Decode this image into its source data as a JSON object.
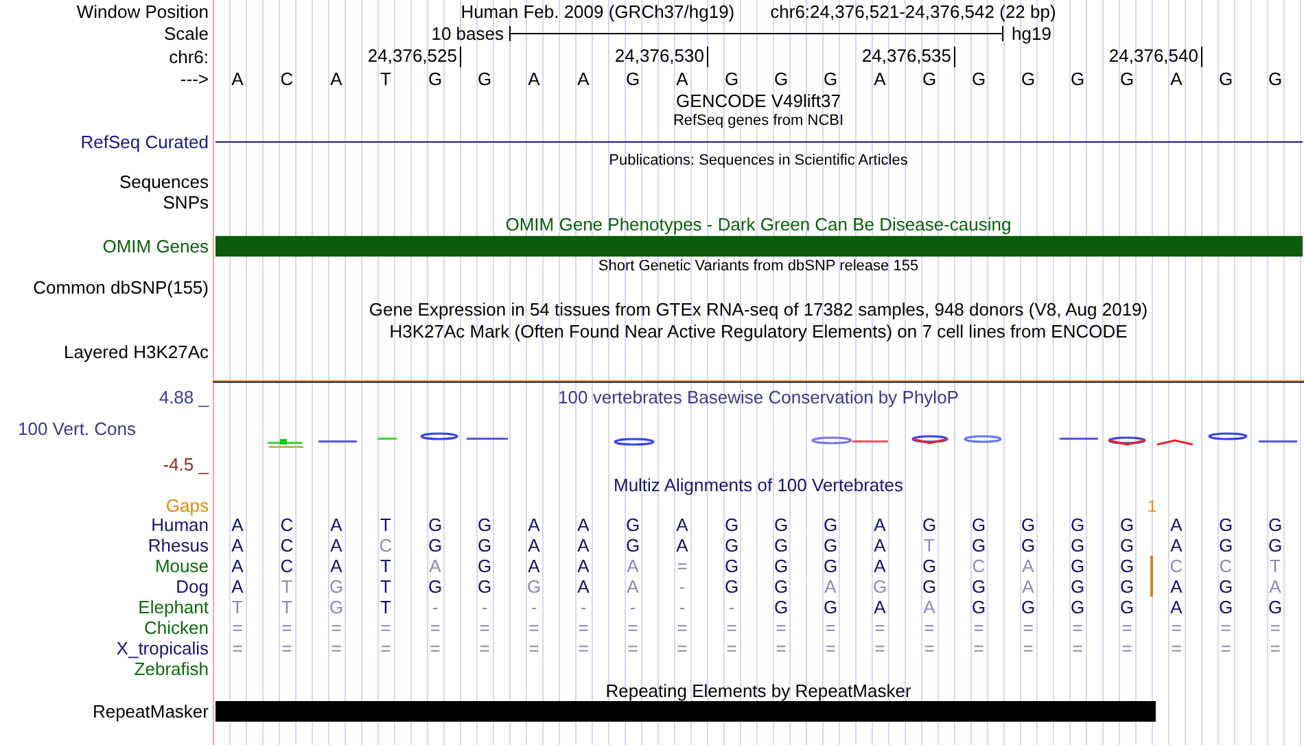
{
  "window_position": {
    "label": "Window Position",
    "assembly": "Human Feb. 2009 (GRCh37/hg19)",
    "position": "chr6:24,376,521-24,376,542 (22 bp)"
  },
  "scale": {
    "label": "Scale",
    "length": "10 bases",
    "assembly": "hg19"
  },
  "ruler": {
    "label": "chr6:",
    "ticks": [
      "24,376,525",
      "24,376,530",
      "24,376,535",
      "24,376,540"
    ]
  },
  "sequence": {
    "label": "--->",
    "bases": [
      "A",
      "C",
      "A",
      "T",
      "G",
      "G",
      "A",
      "A",
      "G",
      "A",
      "G",
      "G",
      "G",
      "A",
      "G",
      "G",
      "G",
      "G",
      "G",
      "A",
      "G",
      "G"
    ]
  },
  "tracks": [
    {
      "kind": "title",
      "text": "GENCODE V49lift37"
    },
    {
      "kind": "note",
      "text": "RefSeq genes from NCBI"
    },
    {
      "kind": "line",
      "label": "RefSeq Curated",
      "color": "#1a1a80"
    },
    {
      "kind": "note",
      "text": "Publications: Sequences in Scientific Articles"
    },
    {
      "kind": "label",
      "label": "Sequences"
    },
    {
      "kind": "label",
      "label": "SNPs"
    },
    {
      "kind": "title",
      "text": "OMIM Gene Phenotypes - Dark Green Can Be Disease-causing",
      "color": "#0b5d0b"
    },
    {
      "kind": "bar",
      "label": "OMIM Genes",
      "color": "#0b5d0b"
    },
    {
      "kind": "note",
      "text": "Short Genetic Variants from dbSNP release 155"
    },
    {
      "kind": "label",
      "label": "Common dbSNP(155)"
    },
    {
      "kind": "title",
      "text": "Gene Expression in 54 tissues from GTEx RNA-seq of 17382 samples, 948 donors (V8, Aug 2019)"
    },
    {
      "kind": "title",
      "text": "H3K27Ac Mark (Often Found Near Active Regulatory Elements) on 7 cell lines from ENCODE"
    },
    {
      "kind": "label",
      "label": "Layered H3K27Ac"
    }
  ],
  "conservation": {
    "title": "100 vertebrates Basewise Conservation by PhyloP",
    "label": "100 Vert. Cons",
    "max": "4.88 _",
    "min": "-4.5 _"
  },
  "multiz": {
    "title": "Multiz Alignments of 100 Vertebrates",
    "gaps_label": "Gaps",
    "gap_count": "1",
    "species": [
      {
        "name": "Human",
        "color": "#14146e",
        "bases": [
          {
            "base": "A",
            "faded": false,
            "insertion": false
          },
          {
            "base": "C",
            "faded": false,
            "insertion": false
          },
          {
            "base": "A",
            "faded": false,
            "insertion": false
          },
          {
            "base": "T",
            "faded": false,
            "insertion": false
          },
          {
            "base": "G",
            "faded": false,
            "insertion": false
          },
          {
            "base": "G",
            "faded": false,
            "insertion": false
          },
          {
            "base": "A",
            "faded": false,
            "insertion": false
          },
          {
            "base": "A",
            "faded": false,
            "insertion": false
          },
          {
            "base": "G",
            "faded": false,
            "insertion": false
          },
          {
            "base": "A",
            "faded": false,
            "insertion": false
          },
          {
            "base": "G",
            "faded": false,
            "insertion": false
          },
          {
            "base": "G",
            "faded": false,
            "insertion": false
          },
          {
            "base": "G",
            "faded": false,
            "insertion": false
          },
          {
            "base": "A",
            "faded": false,
            "insertion": false
          },
          {
            "base": "G",
            "faded": false,
            "insertion": false
          },
          {
            "base": "G",
            "faded": false,
            "insertion": false
          },
          {
            "base": "G",
            "faded": false,
            "insertion": false
          },
          {
            "base": "G",
            "faded": false,
            "insertion": false
          },
          {
            "base": "G",
            "faded": false,
            "insertion": false
          },
          {
            "base": "A",
            "faded": false,
            "insertion": false
          },
          {
            "base": "G",
            "faded": false,
            "insertion": false
          },
          {
            "base": "G",
            "faded": false,
            "insertion": false
          }
        ]
      },
      {
        "name": "Rhesus",
        "color": "#14146e",
        "bases": [
          {
            "base": "A",
            "faded": false,
            "insertion": false
          },
          {
            "base": "C",
            "faded": false,
            "insertion": false
          },
          {
            "base": "A",
            "faded": false,
            "insertion": false
          },
          {
            "base": "C",
            "faded": true,
            "insertion": false
          },
          {
            "base": "G",
            "faded": false,
            "insertion": false
          },
          {
            "base": "G",
            "faded": false,
            "insertion": false
          },
          {
            "base": "A",
            "faded": false,
            "insertion": false
          },
          {
            "base": "A",
            "faded": false,
            "insertion": false
          },
          {
            "base": "G",
            "faded": false,
            "insertion": false
          },
          {
            "base": "A",
            "faded": false,
            "insertion": false
          },
          {
            "base": "G",
            "faded": false,
            "insertion": false
          },
          {
            "base": "G",
            "faded": false,
            "insertion": false
          },
          {
            "base": "G",
            "faded": false,
            "insertion": false
          },
          {
            "base": "A",
            "faded": false,
            "insertion": false
          },
          {
            "base": "T",
            "faded": true,
            "insertion": false
          },
          {
            "base": "G",
            "faded": false,
            "insertion": false
          },
          {
            "base": "G",
            "faded": false,
            "insertion": false
          },
          {
            "base": "G",
            "faded": false,
            "insertion": false
          },
          {
            "base": "G",
            "faded": false,
            "insertion": false
          },
          {
            "base": "A",
            "faded": false,
            "insertion": false
          },
          {
            "base": "G",
            "faded": false,
            "insertion": false
          },
          {
            "base": "G",
            "faded": false,
            "insertion": false
          }
        ]
      },
      {
        "name": "Mouse",
        "color": "#0b6b0b",
        "bases": [
          {
            "base": "A",
            "faded": false,
            "insertion": false
          },
          {
            "base": "C",
            "faded": false,
            "insertion": false
          },
          {
            "base": "A",
            "faded": false,
            "insertion": false
          },
          {
            "base": "T",
            "faded": false,
            "insertion": false
          },
          {
            "base": "A",
            "faded": true,
            "insertion": false
          },
          {
            "base": "G",
            "faded": false,
            "insertion": false
          },
          {
            "base": "A",
            "faded": false,
            "insertion": false
          },
          {
            "base": "A",
            "faded": false,
            "insertion": false
          },
          {
            "base": "A",
            "faded": true,
            "insertion": false
          },
          {
            "base": "=",
            "faded": true,
            "insertion": false
          },
          {
            "base": "G",
            "faded": false,
            "insertion": false
          },
          {
            "base": "G",
            "faded": false,
            "insertion": false
          },
          {
            "base": "G",
            "faded": false,
            "insertion": false
          },
          {
            "base": "A",
            "faded": false,
            "insertion": false
          },
          {
            "base": "G",
            "faded": false,
            "insertion": false
          },
          {
            "base": "C",
            "faded": true,
            "insertion": false
          },
          {
            "base": "A",
            "faded": true,
            "insertion": false
          },
          {
            "base": "G",
            "faded": false,
            "insertion": false
          },
          {
            "base": "G",
            "faded": false,
            "insertion": false
          },
          {
            "base": "C",
            "faded": true,
            "insertion": true
          },
          {
            "base": "C",
            "faded": true,
            "insertion": false
          },
          {
            "base": "T",
            "faded": true,
            "insertion": false
          }
        ]
      },
      {
        "name": "Dog",
        "color": "#14146e",
        "bases": [
          {
            "base": "A",
            "faded": false,
            "insertion": false
          },
          {
            "base": "T",
            "faded": true,
            "insertion": false
          },
          {
            "base": "G",
            "faded": true,
            "insertion": false
          },
          {
            "base": "T",
            "faded": false,
            "insertion": false
          },
          {
            "base": "G",
            "faded": false,
            "insertion": false
          },
          {
            "base": "G",
            "faded": false,
            "insertion": false
          },
          {
            "base": "G",
            "faded": true,
            "insertion": false
          },
          {
            "base": "A",
            "faded": false,
            "insertion": false
          },
          {
            "base": "A",
            "faded": true,
            "insertion": false
          },
          {
            "base": "-",
            "faded": true,
            "insertion": false
          },
          {
            "base": "G",
            "faded": false,
            "insertion": false
          },
          {
            "base": "G",
            "faded": false,
            "insertion": false
          },
          {
            "base": "A",
            "faded": true,
            "insertion": false
          },
          {
            "base": "G",
            "faded": true,
            "insertion": false
          },
          {
            "base": "G",
            "faded": false,
            "insertion": false
          },
          {
            "base": "G",
            "faded": false,
            "insertion": false
          },
          {
            "base": "A",
            "faded": true,
            "insertion": false
          },
          {
            "base": "G",
            "faded": false,
            "insertion": false
          },
          {
            "base": "G",
            "faded": false,
            "insertion": false
          },
          {
            "base": "A",
            "faded": false,
            "insertion": true
          },
          {
            "base": "G",
            "faded": false,
            "insertion": false
          },
          {
            "base": "A",
            "faded": true,
            "insertion": false
          }
        ]
      },
      {
        "name": "Elephant",
        "color": "#0b6b0b",
        "bases": [
          {
            "base": "T",
            "faded": true,
            "insertion": false
          },
          {
            "base": "T",
            "faded": true,
            "insertion": false
          },
          {
            "base": "G",
            "faded": true,
            "insertion": false
          },
          {
            "base": "T",
            "faded": false,
            "insertion": false
          },
          {
            "base": "-",
            "faded": true,
            "insertion": false
          },
          {
            "base": "-",
            "faded": true,
            "insertion": false
          },
          {
            "base": "-",
            "faded": true,
            "insertion": false
          },
          {
            "base": "-",
            "faded": true,
            "insertion": false
          },
          {
            "base": "-",
            "faded": true,
            "insertion": false
          },
          {
            "base": "-",
            "faded": true,
            "insertion": false
          },
          {
            "base": "-",
            "faded": true,
            "insertion": false
          },
          {
            "base": "G",
            "faded": false,
            "insertion": false
          },
          {
            "base": "G",
            "faded": false,
            "insertion": false
          },
          {
            "base": "A",
            "faded": false,
            "insertion": false
          },
          {
            "base": "A",
            "faded": true,
            "insertion": false
          },
          {
            "base": "G",
            "faded": false,
            "insertion": false
          },
          {
            "base": "G",
            "faded": false,
            "insertion": false
          },
          {
            "base": "G",
            "faded": false,
            "insertion": false
          },
          {
            "base": "G",
            "faded": false,
            "insertion": false
          },
          {
            "base": "A",
            "faded": false,
            "insertion": false
          },
          {
            "base": "G",
            "faded": false,
            "insertion": false
          },
          {
            "base": "G",
            "faded": false,
            "insertion": false
          }
        ]
      },
      {
        "name": "Chicken",
        "color": "#0b6b0b",
        "bases": [
          {
            "base": "=",
            "faded": true,
            "insertion": false
          },
          {
            "base": "=",
            "faded": true,
            "insertion": false
          },
          {
            "base": "=",
            "faded": true,
            "insertion": false
          },
          {
            "base": "=",
            "faded": true,
            "insertion": false
          },
          {
            "base": "=",
            "faded": true,
            "insertion": false
          },
          {
            "base": "=",
            "faded": true,
            "insertion": false
          },
          {
            "base": "=",
            "faded": true,
            "insertion": false
          },
          {
            "base": "=",
            "faded": true,
            "insertion": false
          },
          {
            "base": "=",
            "faded": true,
            "insertion": false
          },
          {
            "base": "=",
            "faded": true,
            "insertion": false
          },
          {
            "base": "=",
            "faded": true,
            "insertion": false
          },
          {
            "base": "=",
            "faded": true,
            "insertion": false
          },
          {
            "base": "=",
            "faded": true,
            "insertion": false
          },
          {
            "base": "=",
            "faded": true,
            "insertion": false
          },
          {
            "base": "=",
            "faded": true,
            "insertion": false
          },
          {
            "base": "=",
            "faded": true,
            "insertion": false
          },
          {
            "base": "=",
            "faded": true,
            "insertion": false
          },
          {
            "base": "=",
            "faded": true,
            "insertion": false
          },
          {
            "base": "=",
            "faded": true,
            "insertion": false
          },
          {
            "base": "=",
            "faded": true,
            "insertion": false
          },
          {
            "base": "=",
            "faded": true,
            "insertion": false
          },
          {
            "base": "=",
            "faded": true,
            "insertion": false
          }
        ]
      },
      {
        "name": "X_tropicalis",
        "color": "#14146e",
        "bases": [
          {
            "base": "=",
            "faded": true,
            "insertion": false
          },
          {
            "base": "=",
            "faded": true,
            "insertion": false
          },
          {
            "base": "=",
            "faded": true,
            "insertion": false
          },
          {
            "base": "=",
            "faded": true,
            "insertion": false
          },
          {
            "base": "=",
            "faded": true,
            "insertion": false
          },
          {
            "base": "=",
            "faded": true,
            "insertion": false
          },
          {
            "base": "=",
            "faded": true,
            "insertion": false
          },
          {
            "base": "=",
            "faded": true,
            "insertion": false
          },
          {
            "base": "=",
            "faded": true,
            "insertion": false
          },
          {
            "base": "=",
            "faded": true,
            "insertion": false
          },
          {
            "base": "=",
            "faded": true,
            "insertion": false
          },
          {
            "base": "=",
            "faded": true,
            "insertion": false
          },
          {
            "base": "=",
            "faded": true,
            "insertion": false
          },
          {
            "base": "=",
            "faded": true,
            "insertion": false
          },
          {
            "base": "=",
            "faded": true,
            "insertion": false
          },
          {
            "base": "=",
            "faded": true,
            "insertion": false
          },
          {
            "base": "=",
            "faded": true,
            "insertion": false
          },
          {
            "base": "=",
            "faded": true,
            "insertion": false
          },
          {
            "base": "=",
            "faded": true,
            "insertion": false
          },
          {
            "base": "=",
            "faded": true,
            "insertion": false
          },
          {
            "base": "=",
            "faded": true,
            "insertion": false
          },
          {
            "base": "=",
            "faded": true,
            "insertion": false
          }
        ]
      },
      {
        "name": "Zebrafish",
        "color": "#0b6b0b"
      }
    ]
  },
  "repeats": {
    "title": "Repeating Elements by RepeatMasker",
    "label": "RepeatMasker"
  }
}
